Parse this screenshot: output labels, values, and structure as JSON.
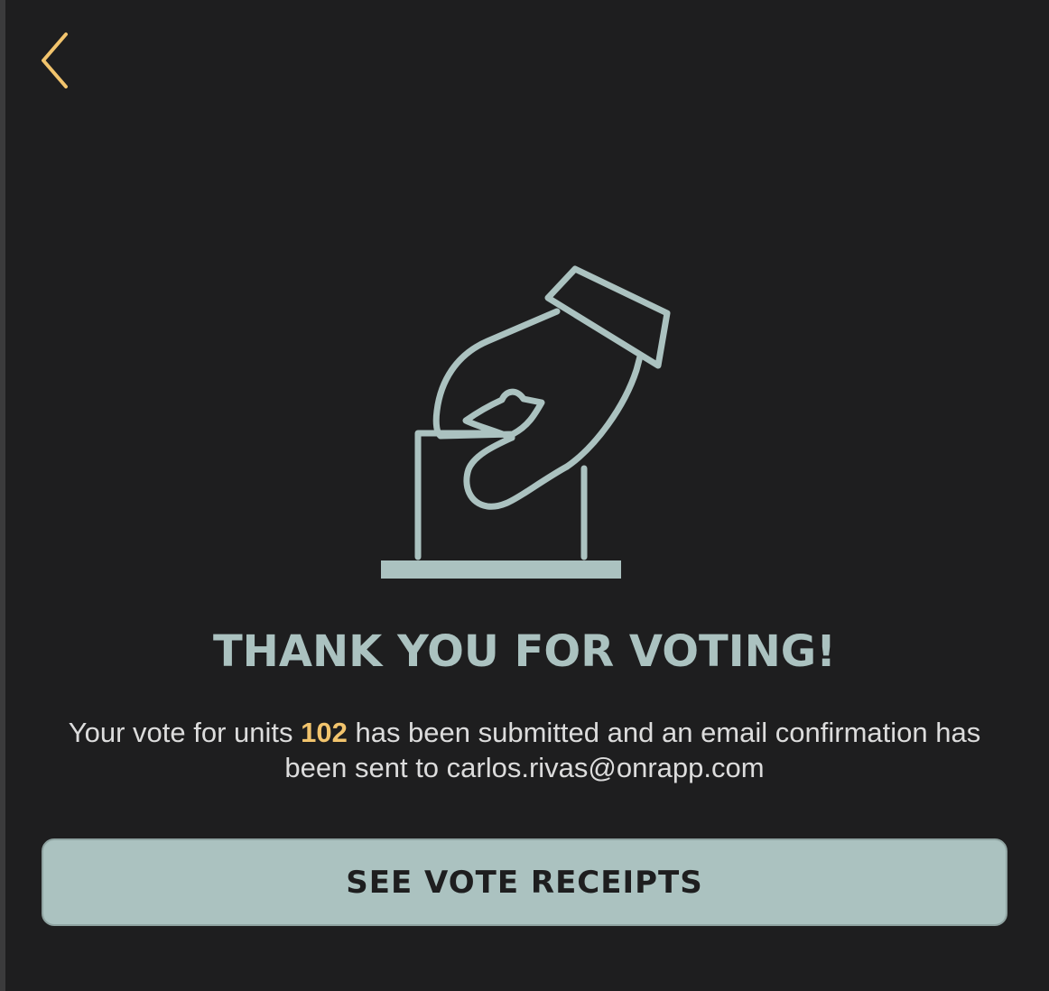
{
  "nav": {
    "back_icon": "chevron-left-icon"
  },
  "illustration": {
    "icon": "ballot-box-vote-icon"
  },
  "confirmation": {
    "title": "THANK YOU FOR VOTING!",
    "message_prefix": "Your vote for units ",
    "units": "102",
    "message_suffix": " has been submitted and an email confirmation has been sent to carlos.rivas@onrapp.com"
  },
  "actions": {
    "receipts_label": "SEE VOTE RECEIPTS"
  },
  "colors": {
    "background": "#1e1e1f",
    "accent": "#f2c46d",
    "primary": "#abc2c0",
    "text": "#dcdcdc"
  }
}
